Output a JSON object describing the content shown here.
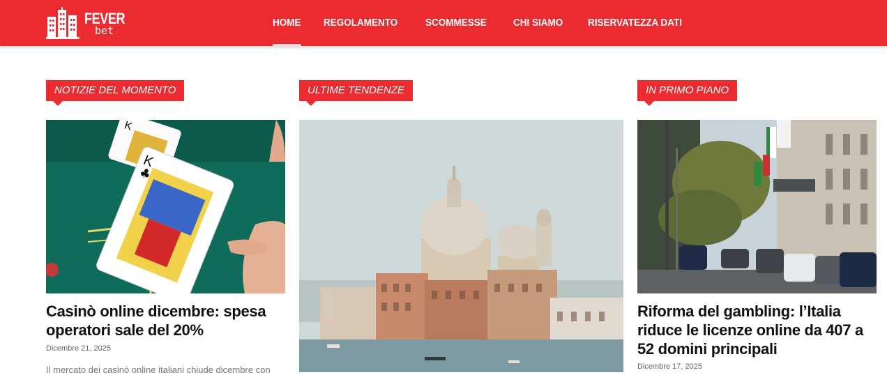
{
  "brand": {
    "name_line1": "FEVER",
    "name_line2": "bet"
  },
  "nav": [
    {
      "label": "HOME",
      "active": true
    },
    {
      "label": "REGOLAMENTO",
      "active": false
    },
    {
      "label": "SCOMMESSE",
      "active": false
    },
    {
      "label": "CHI SIAMO",
      "active": false
    },
    {
      "label": "RISERVATEZZA DATI",
      "active": false
    }
  ],
  "colors": {
    "brand_red": "#eb2b2f"
  },
  "columns": [
    {
      "section_label": "NOTIZIE DEL MOMENTO",
      "title": "Casinò online dicembre: spesa operatori sale del 20%",
      "date": "Dicembre 21, 2025",
      "excerpt": "Il mercato dei casinò online italiani chiude dicembre con"
    },
    {
      "section_label": "ULTIME TENDENZE"
    },
    {
      "section_label": "IN PRIMO PIANO",
      "title": "Riforma del gambling: l’Italia riduce le licenze online da 407 a 52 domini principali",
      "date": "Dicembre 17, 2025"
    }
  ]
}
